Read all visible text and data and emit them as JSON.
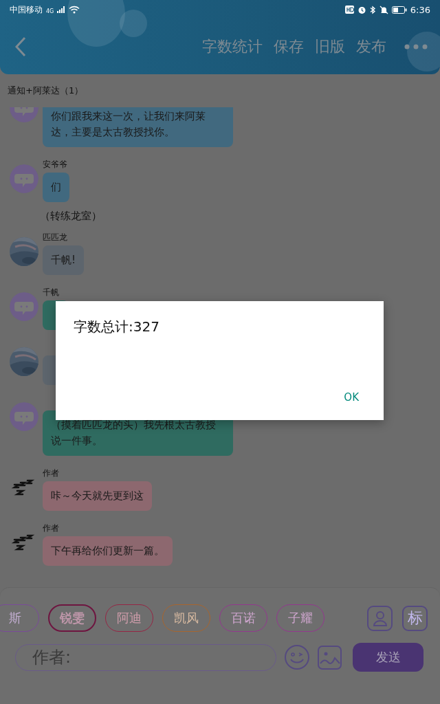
{
  "status_bar": {
    "carrier": "中国移动",
    "network": "4G",
    "time": "6:36"
  },
  "header": {
    "actions": [
      "字数统计",
      "保存",
      "旧版",
      "发布"
    ]
  },
  "conversation": {
    "title": "通知+阿莱达（1）"
  },
  "messages": [
    {
      "kind": "message",
      "avatar": {
        "kind": "bot"
      },
      "text": "你们跟我来这一次，让我们来阿莱达，主要是太古教授找你。",
      "color": "#41697f"
    },
    {
      "kind": "message",
      "avatar": {
        "kind": "bot"
      },
      "name": "安爷爷",
      "text": "们",
      "color": "#41697f"
    },
    {
      "kind": "narration",
      "text": "（转练龙室）"
    },
    {
      "kind": "message",
      "name": "匹匹龙",
      "text": "千帆!",
      "color": "#5d656d"
    },
    {
      "kind": "message",
      "avatar": {
        "kind": "bot"
      },
      "name": "千帆",
      "color": "#2f6b60"
    },
    {
      "kind": "message",
      "color": "#5d656d"
    },
    {
      "kind": "message",
      "avatar": {
        "kind": "bot"
      },
      "text": "（摸着匹匹龙的头）我先根太古教授说一件事。",
      "color": "#2f6b60"
    },
    {
      "kind": "message",
      "avatar": {
        "kind": "zzz"
      },
      "name": "作者",
      "text": "咔～今天就先更到这",
      "color": "#8d686f"
    },
    {
      "kind": "message",
      "avatar": {
        "kind": "zzz"
      },
      "name": "作者",
      "text": "下午再给你们更新一篇。",
      "color": "#8d686f"
    }
  ],
  "composer": {
    "characters": [
      {
        "label": "斯",
        "color": "#7a4a9a",
        "selected": false
      },
      {
        "label": "锐雯",
        "color": "#6e1540",
        "selected": true
      },
      {
        "label": "阿迪",
        "color": "#962544",
        "selected": false
      },
      {
        "label": "凯风",
        "color": "#a8652d",
        "selected": false
      },
      {
        "label": "百诺",
        "color": "#93378f",
        "selected": false
      },
      {
        "label": "子耀",
        "color": "#93378f",
        "selected": false
      }
    ],
    "tag_key": "标",
    "placeholder": "作者:",
    "send": "发送"
  },
  "dialog": {
    "message": "字数总计:327",
    "button": "OK"
  }
}
